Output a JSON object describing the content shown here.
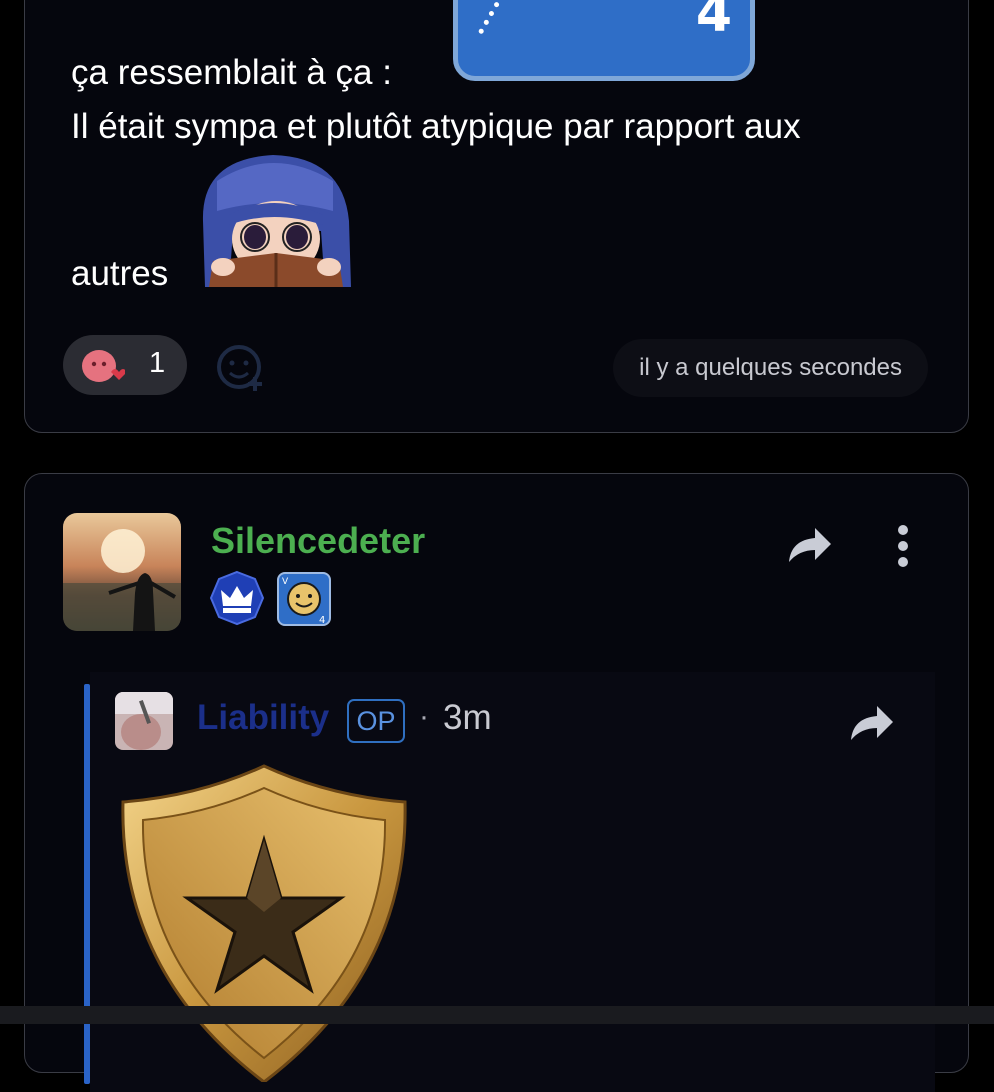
{
  "post": {
    "line1": "ça ressemblait à ça :",
    "line2": "Il était sympa et plutôt atypique par rapport aux",
    "line3": "autres",
    "sticker_badge_number": "4",
    "reaction_count": "1",
    "timestamp": "il y a quelques secondes"
  },
  "reply": {
    "username": "Silencedeter",
    "username_color": "#4caf50",
    "badge_smile_letter": "V",
    "badge_smile_number": "4",
    "quote": {
      "username": "Liability",
      "op_label": "OP",
      "separator": "·",
      "time": "3m"
    }
  },
  "icons": [
    "share-icon",
    "more-vertical-icon",
    "add-reaction-icon",
    "crown-badge-icon",
    "smiley-badge-icon"
  ],
  "colors": {
    "background": "#000000",
    "card": "#05060d",
    "quote_accent": "#2a63c7",
    "username_green": "#4caf50",
    "quote_username": "#1b2f8a"
  }
}
